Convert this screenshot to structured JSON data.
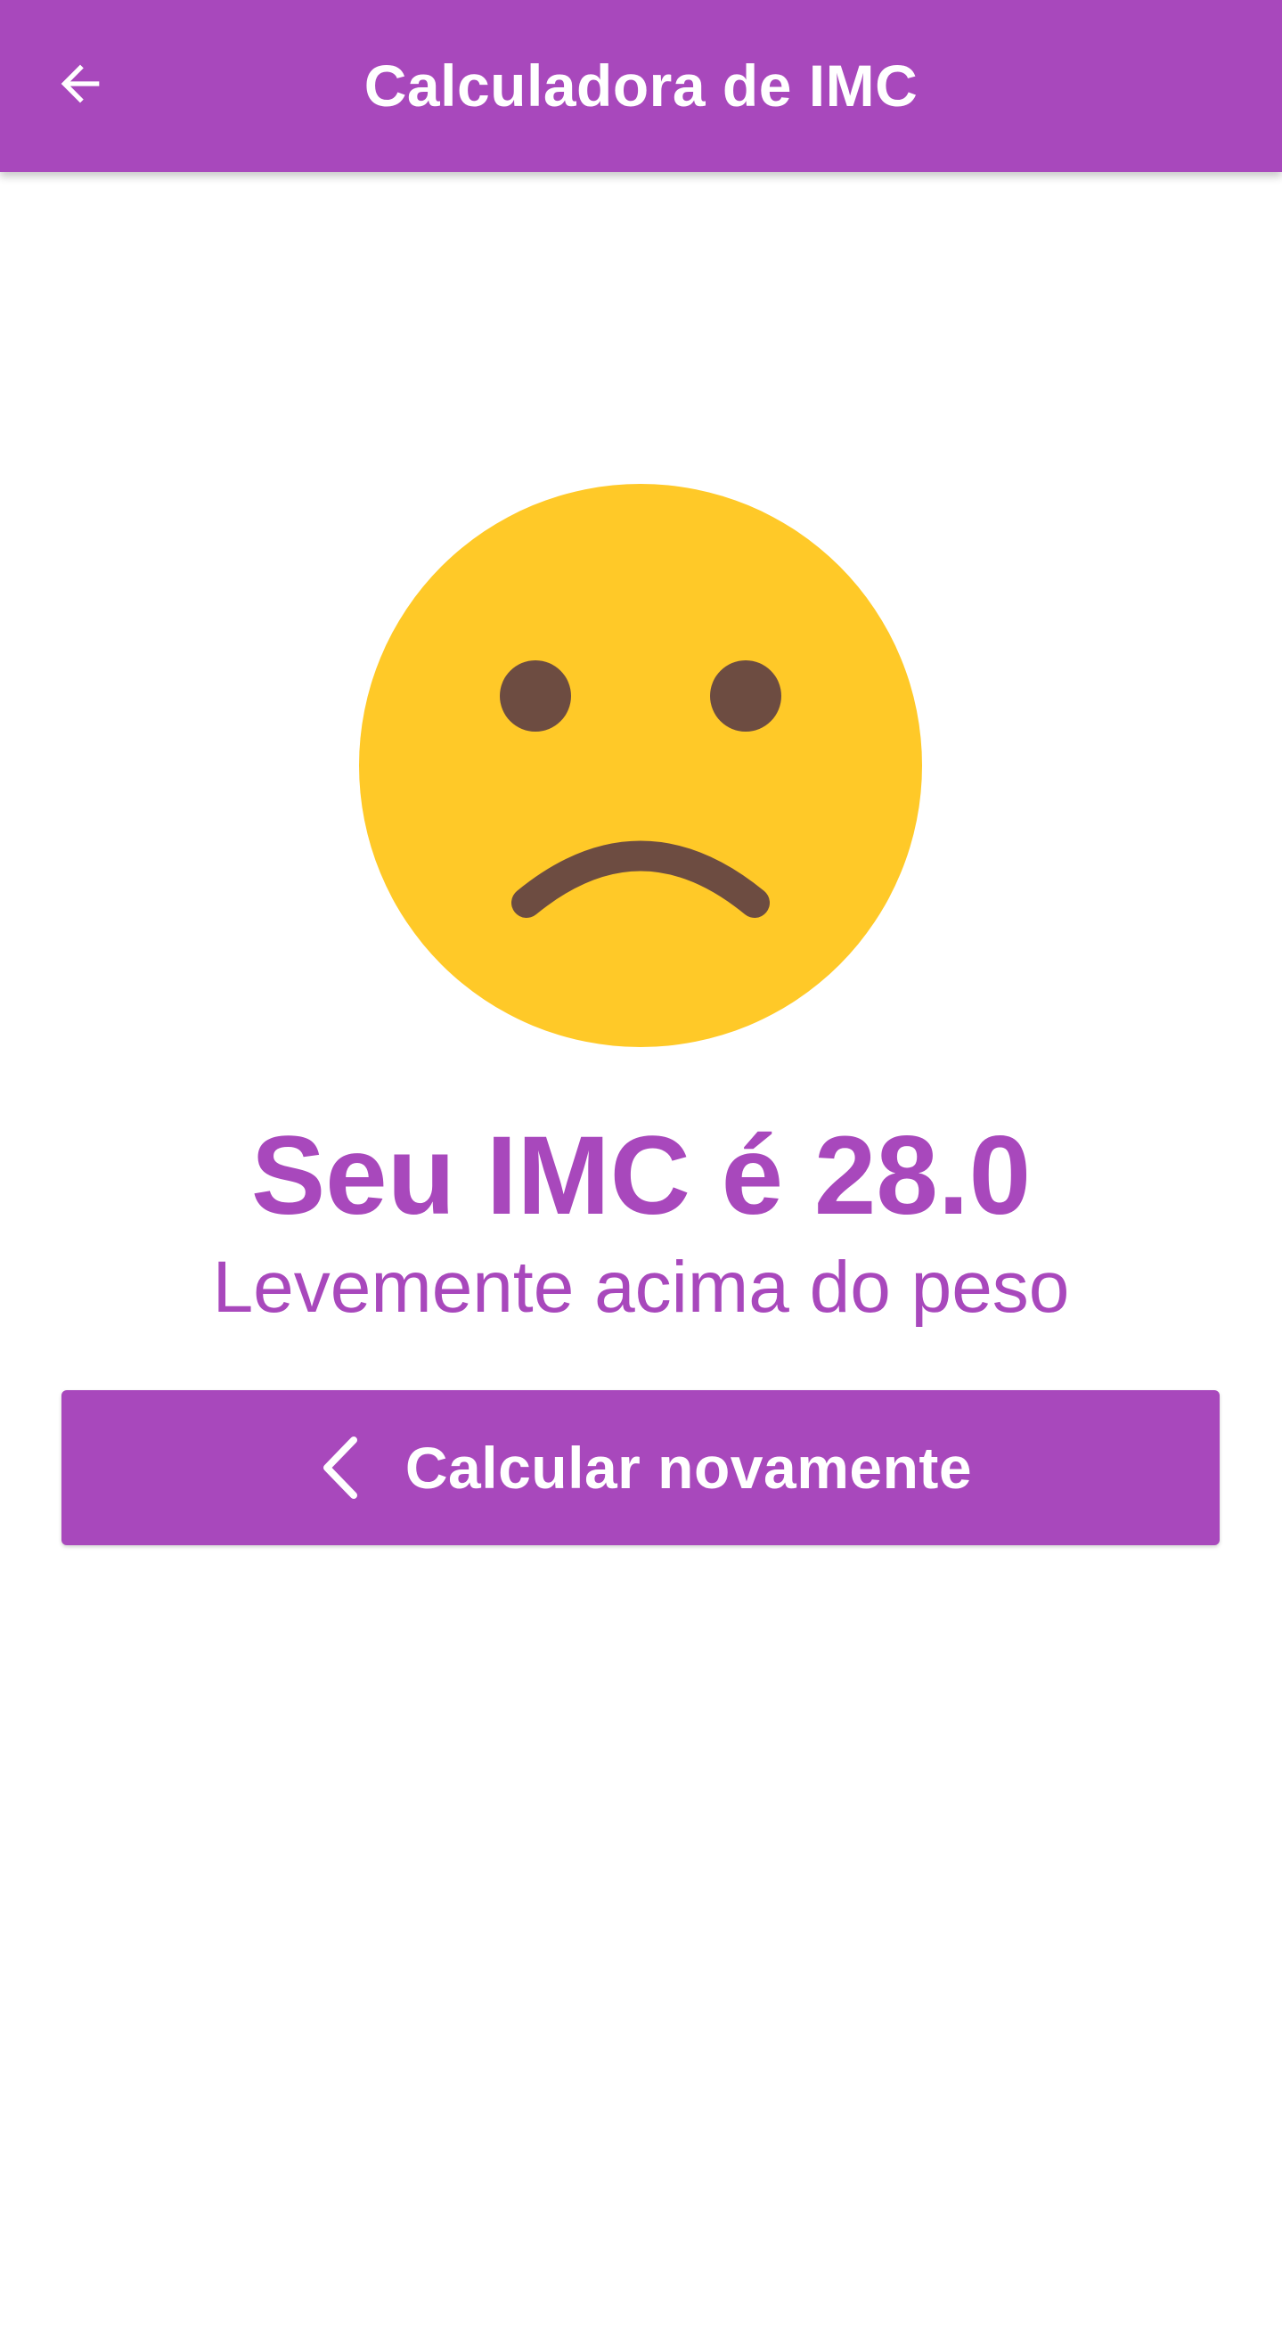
{
  "app_bar": {
    "title": "Calculadora de IMC",
    "back_icon": "arrow-left-icon",
    "background_color": "#a848bc"
  },
  "result": {
    "emoji_icon": "sad-face-icon",
    "bmi_text": "Seu IMC é 28.0",
    "category": "Levemente acima do peso",
    "accent_color": "#a848bc"
  },
  "recalculate_button": {
    "icon": "chevron-left-icon",
    "label": "Calcular novamente"
  }
}
